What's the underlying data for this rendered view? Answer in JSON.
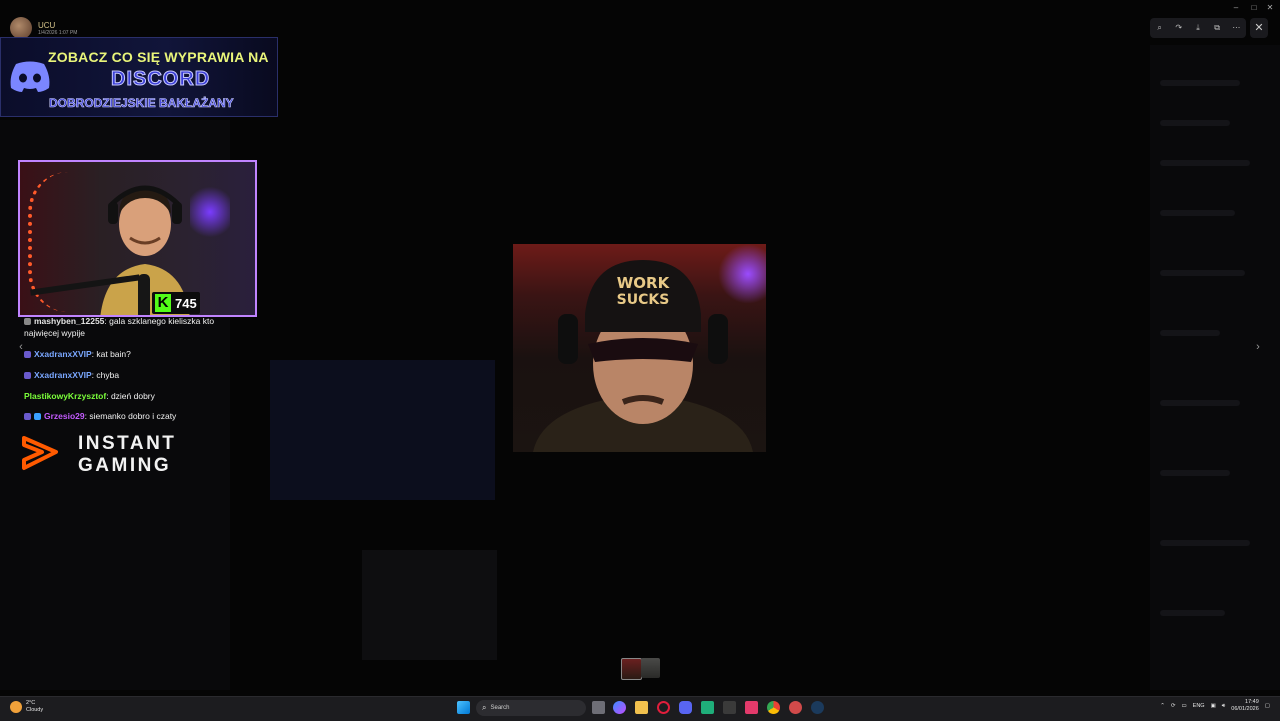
{
  "viewer": {
    "username": "UCU",
    "timestamp": "1/4/2026 1:07 PM",
    "toolbar_icons": [
      "zoom-icon",
      "forward-icon",
      "download-icon",
      "open-external-icon",
      "more-icon"
    ],
    "close_icon": "close-icon"
  },
  "discord_banner": {
    "line1": "ZOBACZ CO SIĘ WYPRAWIA NA",
    "line2": "DISCORD",
    "line3": "DOBRODZIEJSKIE BAKŁAŻANY",
    "accent": "#5865F2"
  },
  "kick": {
    "letter": "K",
    "viewer_count": "745",
    "color": "#53FC18"
  },
  "chat": [
    {
      "user": "mashyben_12255",
      "text": "gala szklanego kieliszka kto",
      "color": "#e4e4e4"
    },
    {
      "user": "",
      "text": "najwięcej wypije",
      "color": "#e4e4e4"
    },
    {
      "user": "XxadranxXVIP",
      "text": "kat bain?",
      "color": "#7aa7ff"
    },
    {
      "user": "XxadranxXVIP",
      "text": "chyba",
      "color": "#7aa7ff"
    },
    {
      "user": "PlastikowyKrzysztof",
      "text": "dzień dobry",
      "color": "#7bff3a"
    },
    {
      "user": "Grzesio29",
      "text": "siemanko dobro i czaty",
      "color": "#c45cff"
    }
  ],
  "sponsor": {
    "line1": "INSTANT",
    "line2": "GAMING",
    "color": "#ff5a00"
  },
  "taskbar": {
    "weather_temp": "2°C",
    "weather_desc": "Cloudy",
    "search_placeholder": "Search",
    "language": "ENG",
    "time": "17:49",
    "date": "06/01/2026"
  }
}
